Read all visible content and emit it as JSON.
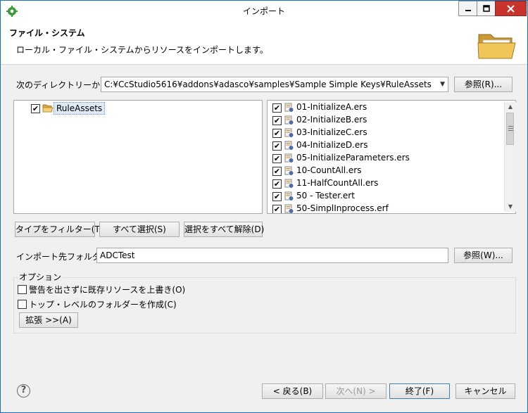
{
  "window": {
    "title": "インポート",
    "controls": {
      "minimize_icon": "minimize-icon",
      "maximize_icon": "maximize-icon",
      "close_icon": "close-icon"
    }
  },
  "header": {
    "title": "ファイル・システム",
    "description": "ローカル・ファイル・システムからリソースをインポートします。"
  },
  "source": {
    "label": "次のディレクトリーから(Y):",
    "value": "C:¥CcStudio5616¥addons¥adasco¥samples¥Sample Simple Keys¥RuleAssets",
    "browse_label": "参照(R)..."
  },
  "tree": {
    "items": [
      {
        "label": "RuleAssets",
        "checked": true
      }
    ]
  },
  "files": [
    {
      "name": "01-InitializeA.ers",
      "checked": true
    },
    {
      "name": "02-InitializeB.ers",
      "checked": true
    },
    {
      "name": "03-InitializeC.ers",
      "checked": true
    },
    {
      "name": "04-InitializeD.ers",
      "checked": true
    },
    {
      "name": "05-InitializeParameters.ers",
      "checked": true
    },
    {
      "name": "10-CountAll.ers",
      "checked": true
    },
    {
      "name": "11-HalfCountAll.ers",
      "checked": true
    },
    {
      "name": "50 - Tester.ert",
      "checked": true
    },
    {
      "name": "50-SimplInprocess.erf",
      "checked": true
    }
  ],
  "selection_buttons": {
    "filter": "タイプをフィルター(T)...",
    "select_all": "すべて選択(S)",
    "deselect_all": "選択をすべて解除(D)"
  },
  "target": {
    "label": "インポート先フォルダ(L):",
    "value": "ADCTest",
    "browse_label": "参照(W)..."
  },
  "options": {
    "label": "オプション",
    "overwrite_label": "警告を出さずに既存リソースを上書き(O)",
    "overwrite_checked": false,
    "create_top_label": "トップ・レベルのフォルダーを作成(C)",
    "create_top_checked": false,
    "advanced_label": "拡張 >>(A)"
  },
  "footer": {
    "back": "< 戻る(B)",
    "next": "次へ(N) >",
    "finish": "終了(F)",
    "cancel": "キャンセル",
    "help_icon": "help-icon"
  },
  "colors": {
    "accent": "#1e6fb8",
    "close_button": "#c7342c",
    "app_icon": "#3a9b3a",
    "folder": "#e8b84a"
  }
}
